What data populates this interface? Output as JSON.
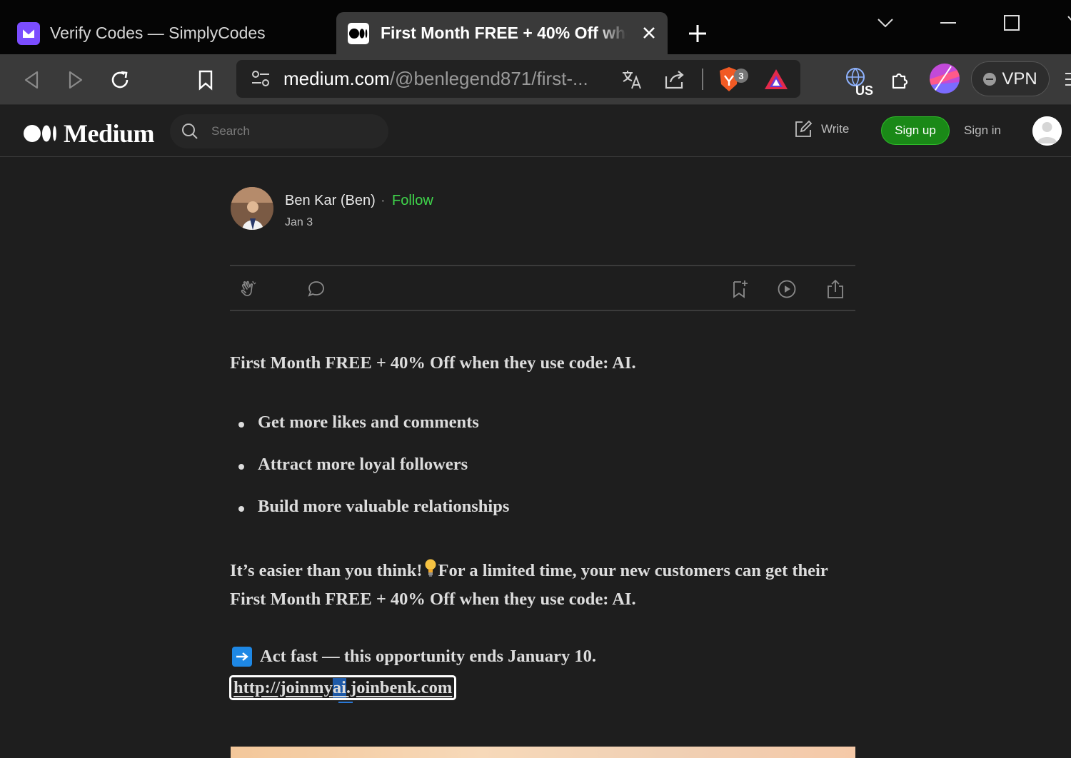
{
  "browser": {
    "tabs": [
      {
        "title": "Verify Codes — SimplyCodes",
        "active": false,
        "favicon": "simplycodes-icon"
      },
      {
        "title": "First Month FREE + 40% Off whe",
        "active": true,
        "favicon": "medium-icon"
      }
    ],
    "url": {
      "host": "medium.com",
      "path": "/@benlegend871/first-..."
    },
    "extension_badge": "3",
    "vpn_label": "VPN",
    "region_label": "US",
    "accent_colors": {
      "tab_active_bg": "#3a3a3a",
      "strip_bg": "#050505"
    }
  },
  "medium": {
    "wordmark": "Medium",
    "search_placeholder": "Search",
    "write_label": "Write",
    "signup_label": "Sign up",
    "signin_label": "Sign in",
    "brand_green": "#1a8917"
  },
  "article": {
    "author": "Ben Kar (Ben)",
    "separator": "·",
    "follow_label": "Follow",
    "date": "Jan 3",
    "lead": "First Month FREE + 40% Off when they use code: AI.",
    "bullets": [
      "Get more likes and comments",
      "Attract more loyal followers",
      "Build more valuable relationships"
    ],
    "easier_part1": "It’s easier than you think!",
    "easier_part2": "For a limited time, your new customers can get their First Month FREE + 40% Off when they use code: AI.",
    "act_fast": "Act fast — this opportunity ends January 10.",
    "link_before": "http://joinmy",
    "link_selected": "ai",
    "link_after": ".joinbenk.com"
  }
}
